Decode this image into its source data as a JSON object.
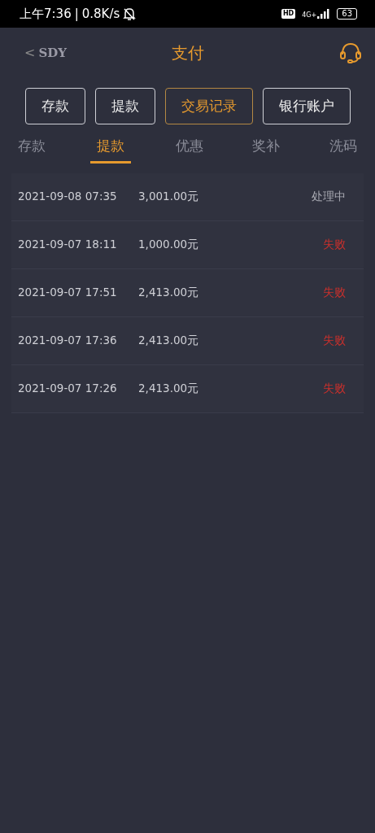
{
  "status_bar": {
    "time": "上午7:36",
    "separator": "|",
    "speed": "0.8K/s",
    "hd": "HD",
    "network": "4G+",
    "battery": "63"
  },
  "header": {
    "back": "<",
    "logo": "SDY",
    "title": "支付"
  },
  "buttons": [
    {
      "label": "存款",
      "selected": false
    },
    {
      "label": "提款",
      "selected": false
    },
    {
      "label": "交易记录",
      "selected": true
    },
    {
      "label": "银行账户",
      "selected": false
    }
  ],
  "tabs": [
    {
      "label": "存款",
      "selected": false
    },
    {
      "label": "提款",
      "selected": true
    },
    {
      "label": "优惠",
      "selected": false
    },
    {
      "label": "奖补",
      "selected": false
    },
    {
      "label": "洗码",
      "selected": false
    }
  ],
  "records": [
    {
      "time": "2021-09-08 07:35",
      "amount": "3,001.00元",
      "status": "处理中",
      "kind": "processing"
    },
    {
      "time": "2021-09-07 18:11",
      "amount": "1,000.00元",
      "status": "失败",
      "kind": "failed"
    },
    {
      "time": "2021-09-07 17:51",
      "amount": "2,413.00元",
      "status": "失败",
      "kind": "failed"
    },
    {
      "time": "2021-09-07 17:36",
      "amount": "2,413.00元",
      "status": "失败",
      "kind": "failed"
    },
    {
      "time": "2021-09-07 17:26",
      "amount": "2,413.00元",
      "status": "失败",
      "kind": "failed"
    }
  ]
}
